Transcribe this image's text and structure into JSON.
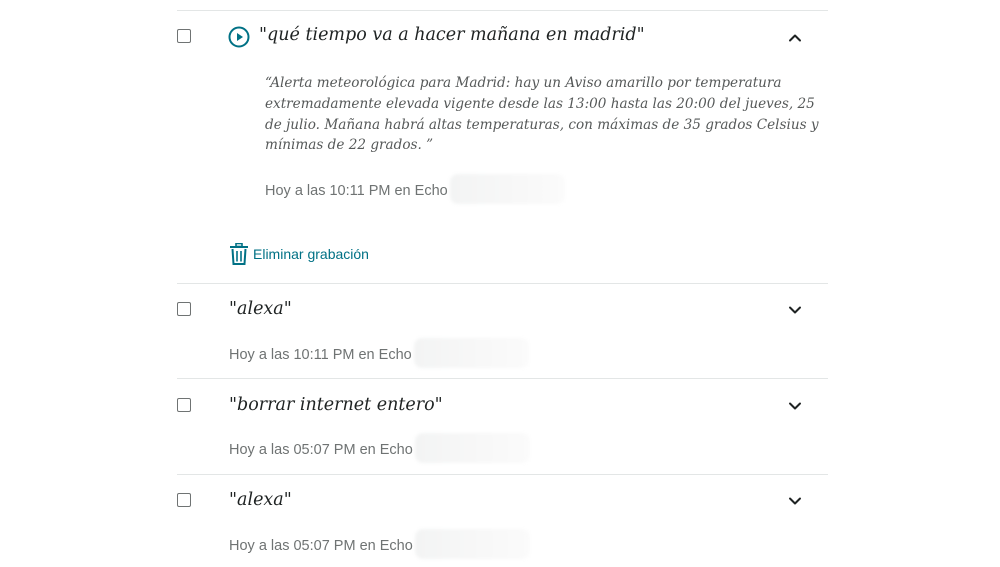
{
  "recordings": [
    {
      "utterance": "\"qué tiempo va a hacer mañana en madrid\"",
      "expanded": true,
      "response": "“Alerta meteorológica para Madrid: hay un Aviso amarillo por temperatura extremadamente elevada vigente desde las 13:00 hasta las 20:00 del jueves, 25 de julio. Mañana habrá altas temperaturas, con máximas de 35 grados Celsius y mínimas de 22 grados. ”",
      "timestamp": "Hoy a las 10:11 PM en Echo",
      "delete_label": "Eliminar grabación"
    },
    {
      "utterance": "\"alexa\"",
      "expanded": false,
      "timestamp": "Hoy a las 10:11 PM en Echo"
    },
    {
      "utterance": "\"borrar internet entero\"",
      "expanded": false,
      "timestamp": "Hoy a las 05:07 PM en Echo"
    },
    {
      "utterance": "\"alexa\"",
      "expanded": false,
      "timestamp": "Hoy a las 05:07 PM en Echo"
    }
  ],
  "icons": {
    "play": "play-circle-icon",
    "collapse": "chevron-up-icon",
    "expand": "chevron-down-icon",
    "delete": "trash-icon"
  },
  "colors": {
    "accent": "#007185",
    "text": "#1f2323",
    "muted": "#6f7373",
    "divider": "#e3e6e6"
  }
}
